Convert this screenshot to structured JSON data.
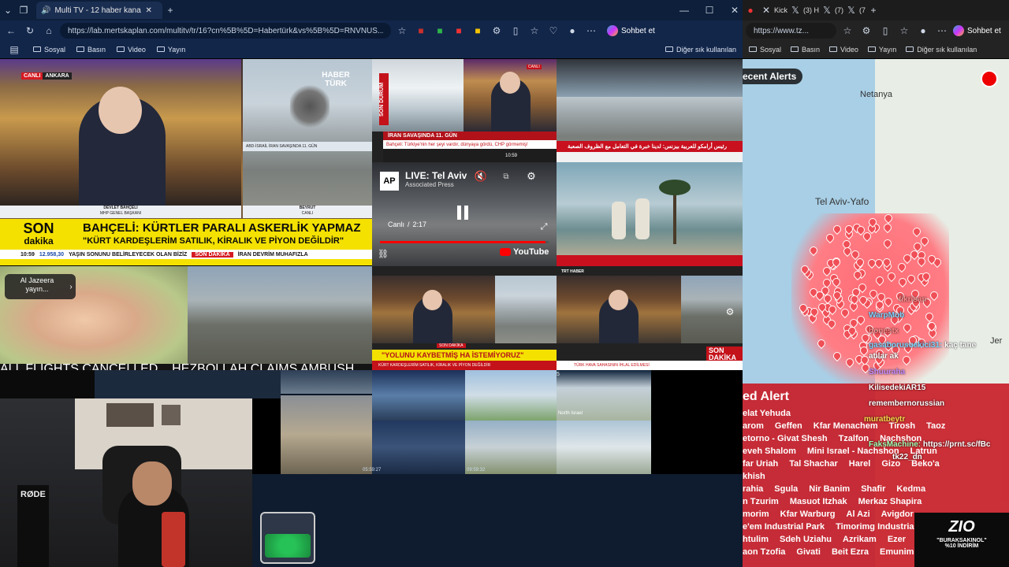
{
  "browser_left": {
    "tab_title": "Multi TV - 12 haber kanalını a",
    "url": "https://lab.mertskaplan.com/multitv/tr/16?cn%5B%5D=Habertürk&vs%5B%5D=RNVNUS...",
    "copilot": "Sohbet et",
    "bookmarks": [
      "Sosyal",
      "Basın",
      "Video",
      "Yayın"
    ],
    "other_bookmarks": "Diğer sık kullanılan"
  },
  "browser_right": {
    "tabs": [
      "Kick",
      "(3) H",
      "(7)",
      "(7"
    ],
    "url": "https://www.tz...",
    "copilot": "Sohbet et",
    "bookmarks": [
      "Sosyal",
      "Basın",
      "Video",
      "Yayın"
    ],
    "other_bookmarks": "Diğer sık kullanılan"
  },
  "haberturk_feed": {
    "live_badge": "CANLI",
    "live_location": "ANKARA",
    "logo": "HABER TÜRK",
    "speaker_name": "DEVLET BAHÇELİ",
    "speaker_title": "MHP GENEL BAŞKANI",
    "location_label": "BEYRUT",
    "location_sub": "CANLI",
    "inset_caption": "ABD-İSRAİL İRAN SAVAŞINDA 11. GÜN",
    "son_dakika_1": "SON",
    "son_dakika_2": "dakika",
    "headline": "BAHÇELİ: KÜRTLER PARALI ASKERLİK YAPMAZ",
    "subheadline": "\"KÜRT KARDEŞLERİM SATILIK, KİRALIK VE PİYON DEĞİLDİR\"",
    "time": "10:59",
    "index": "12.958,30",
    "ticker1": "YAŞIN SONUNU BELİRLEYECEK OLAN BİZİZ",
    "ticker_badge": "SON DAKİKA",
    "ticker2": "İRAN DEVRİM MUHAFIZLA"
  },
  "ntv_feed": {
    "son_durum": "SON DURUM",
    "badge": "CANLI",
    "caption": "İRAN SAVAŞINDA 11. GÜN",
    "ticker": "Bahçeli: Türkiye'nin her şeyi vardır, dünyaya gördü, CHP görmemiş!",
    "clock": "10:59"
  },
  "arabiya_feed": {
    "headline": "رئيس أرامكو للعربية بيزنس: لدينا خبرة في التعامل مع الظروف الصعبة"
  },
  "ap_feed": {
    "logo": "AP",
    "title": "LIVE: Tel Aviv",
    "channel": "Associated Press",
    "status": "Canlı",
    "time": "2:17",
    "youtube": "YouTube",
    "progress": 0.98
  },
  "aljazeera_feed": {
    "tooltip": "Al Jazeera yayın...",
    "ticker": "ALL FLIGHTS CANCELLED... HEZBOLLAH CLAIMS AMBUSH ON ISRAELI TROOPS"
  },
  "trt_feed": {
    "logo": "TRT HABER",
    "badge": "SON DAKİKA",
    "ticker": "TÜRK HAVA SAHASININ İHLAL EDİLMESİ"
  },
  "cnn_feed": {
    "badge": "SON DAKİKA",
    "headline": "\"YOLUNU KAYBETMİŞ HA İSTEMİYORUZ\"",
    "ticker": "KÜRT KARDEŞLERİM SATILIK, KİRALIK VE PİYON DEĞİLDİR"
  },
  "webcams": {
    "timestamps": [
      "05:59:27",
      "09:59:32"
    ],
    "north_label": "North Israel",
    "cam_number": "5"
  },
  "streamer": {
    "mic_label": "RØDE"
  },
  "alerts_map": {
    "header": "ecent Alerts",
    "city_labels": [
      "Netanya",
      "Tel Aviv-Yafo",
      "Jer"
    ],
    "red_alert_title": "ed Alert",
    "red_alert_sub": "elat Yehuda",
    "locations": [
      [
        "arom",
        "Geffen",
        "Kfar Menachem",
        "Tirosh",
        "Taoz"
      ],
      [
        "etorno - Givat Shesh",
        "Tzalfon",
        "Nachshon"
      ],
      [
        "eveh Shalom",
        "Mini Israel - Nachshon",
        "Latrun"
      ],
      [
        "far Uriah",
        "Tal Shachar",
        "Harel",
        "Gizo",
        "Beko'a"
      ],
      [
        "khish"
      ],
      [
        "rahia",
        "Sgula",
        "Nir Banim",
        "Shafir",
        "Kedma"
      ],
      [
        "n Tzurim",
        "Masuot Itzhak",
        "Merkaz Shapira"
      ],
      [
        "morim",
        "Kfar Warburg",
        "Al Azi",
        "Avigdor"
      ],
      [
        "e'em Industrial Park",
        "Timorimg Industria"
      ],
      [
        "htulim",
        "Sdeh Uziahu",
        "Azrikam",
        "Ezer"
      ],
      [
        "aon Tzofia",
        "Givati",
        "Beit Ezra",
        "Emunim"
      ]
    ]
  },
  "chat": {
    "messages": [
      {
        "user": "gasaborusuekici31",
        "text": "kaç tane",
        "color": "#7ad3ff"
      },
      {
        "user": "",
        "text": "atılar ak",
        "color": "#ffffff"
      },
      {
        "user": "Shuuraha",
        "text": "",
        "color": "#c58cff"
      },
      {
        "user": "KilisedekiAR15",
        "text": "",
        "color": "#ffffff"
      },
      {
        "user": "remembernorussian",
        "text": "",
        "color": "#ffffff"
      },
      {
        "user": "muratbeytr",
        "text": "",
        "color": "#ffd94a"
      },
      {
        "user": "FaksMachine",
        "text": "https://prnt.sc/fBc",
        "color": "#a0ffb2"
      },
      {
        "user": "WarpMub",
        "text": "",
        "color": "#7ad3ff"
      },
      {
        "user": "honestx",
        "text": "",
        "color": "#ff8a8a"
      },
      {
        "user": "fikrisan",
        "text": "",
        "color": "#ff8a8a"
      },
      {
        "user": "",
        "text": "tk22_dn",
        "color": "#ffffff"
      }
    ]
  },
  "promo": {
    "logo": "ZIO",
    "code": "\"BURAKSAKINOL\"",
    "discount": "%10 İNDİRİM"
  }
}
